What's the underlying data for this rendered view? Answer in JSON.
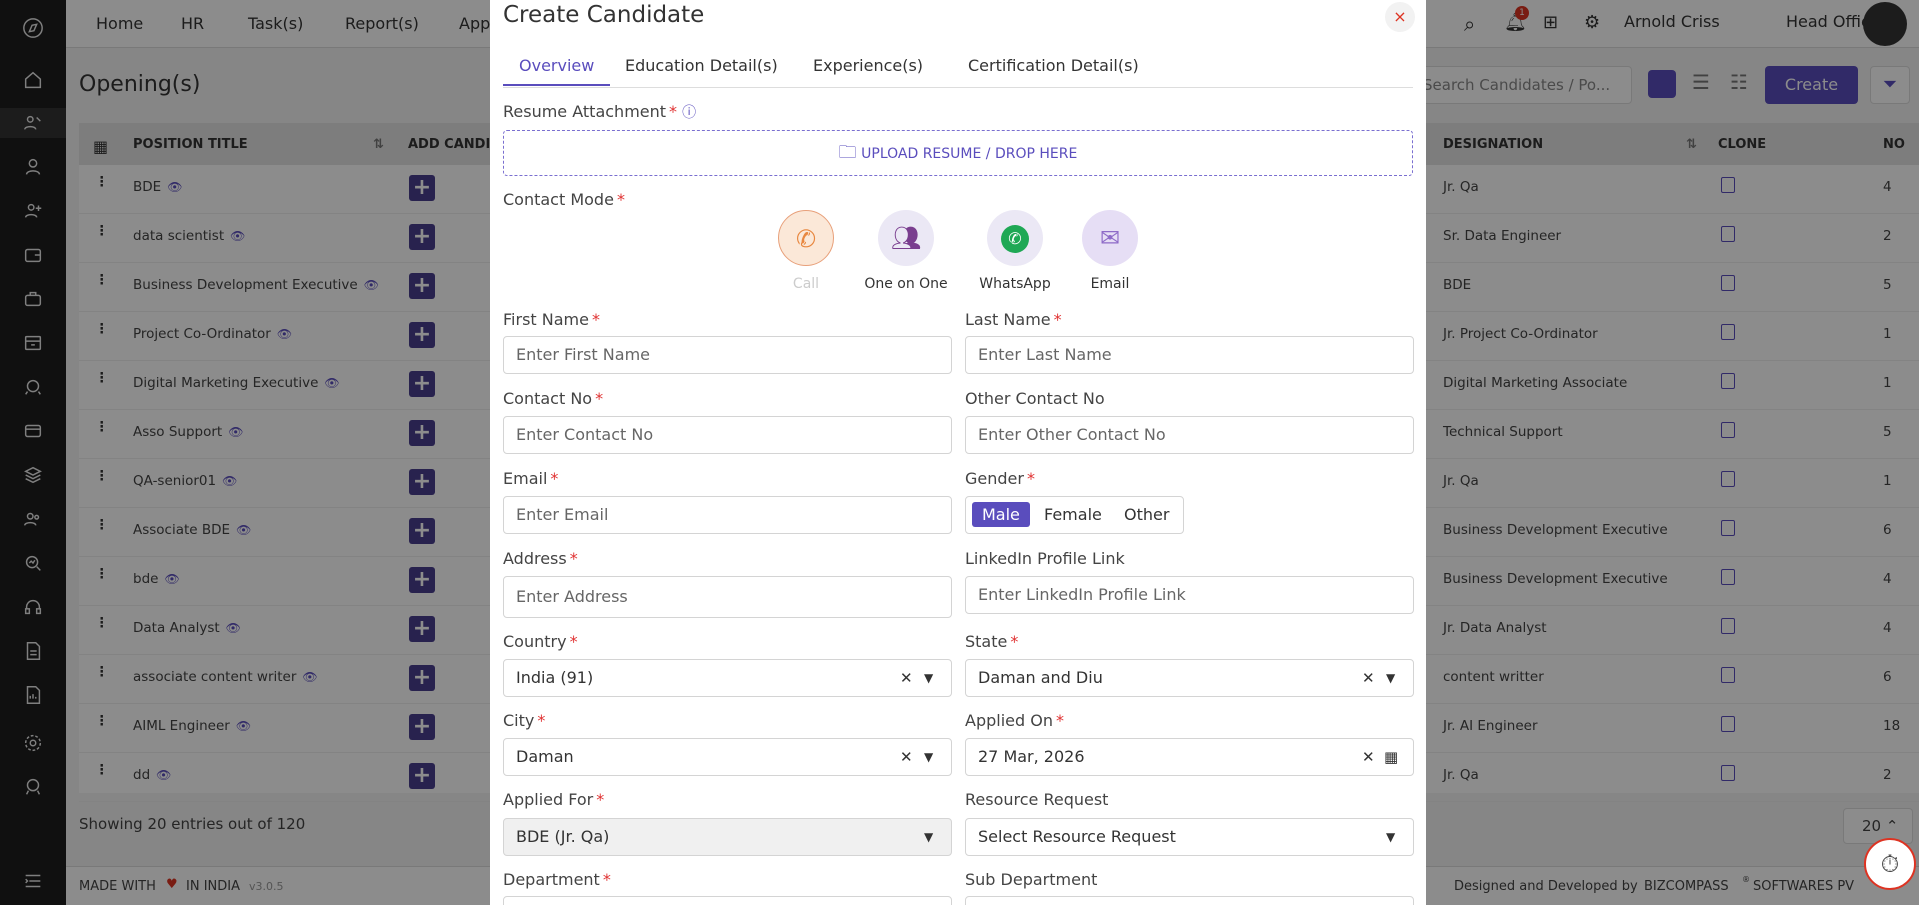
{
  "topnav": {
    "items": [
      "Home",
      "HR",
      "Task(s)",
      "Report(s)",
      "App"
    ],
    "user": "Arnold Criss",
    "office": "Head Office",
    "notif_count": "1"
  },
  "page": {
    "title": "Opening(s)",
    "search_placeholder": "Search Candidates / Po...",
    "create_label": "Create",
    "showing": "Showing 20 entries out of 120",
    "page_size": "20"
  },
  "table": {
    "headers": {
      "position": "POSITION TITLE",
      "add": "ADD CANDI",
      "designation": "DESIGNATION",
      "clone": "CLONE",
      "no": "NO"
    },
    "rows": [
      {
        "title": "BDE",
        "designation": "Jr. Qa",
        "no": "4"
      },
      {
        "title": "data scientist",
        "designation": "Sr. Data Engineer",
        "no": "2"
      },
      {
        "title": "Business Development Executive",
        "designation": "BDE",
        "no": "5"
      },
      {
        "title": "Project Co-Ordinator",
        "designation": "Jr. Project Co-Ordinator",
        "no": "1"
      },
      {
        "title": "Digital Marketing Executive",
        "designation": "Digital Marketing Associate",
        "no": "1"
      },
      {
        "title": "Asso Support",
        "designation": "Technical Support",
        "no": "5"
      },
      {
        "title": "QA-senior01",
        "designation": "Jr. Qa",
        "no": "1"
      },
      {
        "title": "Associate BDE",
        "designation": "Business Development Executive",
        "no": "6"
      },
      {
        "title": "bde",
        "designation": "Business Development Executive",
        "no": "4"
      },
      {
        "title": "Data Analyst",
        "designation": "Jr. Data Analyst",
        "no": "4"
      },
      {
        "title": "associate content writer",
        "designation": "content writter",
        "no": "6"
      },
      {
        "title": "AIML Engineer",
        "designation": "Jr. AI Engineer",
        "no": "18"
      },
      {
        "title": "dd",
        "designation": "Jr. Qa",
        "no": "2"
      }
    ]
  },
  "footer": {
    "made_with": "MADE WITH",
    "in_india": "IN INDIA",
    "version": "v3.0.5",
    "designed_by": "Designed and Developed by",
    "company": "BIZCOMPASS",
    "company_suffix": "SOFTWARES PV"
  },
  "modal": {
    "title": "Create Candidate",
    "close": "×",
    "tabs": [
      "Overview",
      "Education Detail(s)",
      "Experience(s)",
      "Certification Detail(s)"
    ],
    "resume_label": "Resume Attachment",
    "upload_text": "UPLOAD RESUME / DROP HERE",
    "contact_mode_label": "Contact Mode",
    "contact_modes": [
      "Call",
      "One on One",
      "WhatsApp",
      "Email"
    ],
    "first_name": {
      "label": "First Name",
      "placeholder": "Enter First Name"
    },
    "last_name": {
      "label": "Last Name",
      "placeholder": "Enter Last Name"
    },
    "contact_no": {
      "label": "Contact No",
      "placeholder": "Enter Contact No"
    },
    "other_contact": {
      "label": "Other Contact No",
      "placeholder": "Enter Other Contact No"
    },
    "email": {
      "label": "Email",
      "placeholder": "Enter Email"
    },
    "gender": {
      "label": "Gender",
      "options": [
        "Male",
        "Female",
        "Other"
      ],
      "selected": "Male"
    },
    "address": {
      "label": "Address",
      "placeholder": "Enter Address"
    },
    "linkedin": {
      "label": "LinkedIn Profile Link",
      "placeholder": "Enter LinkedIn Profile Link"
    },
    "country": {
      "label": "Country",
      "value": "India (91)"
    },
    "state": {
      "label": "State",
      "value": "Daman and Diu"
    },
    "city": {
      "label": "City",
      "value": "Daman"
    },
    "applied_on": {
      "label": "Applied On",
      "value": "27 Mar, 2026"
    },
    "applied_for": {
      "label": "Applied For",
      "value": "BDE (Jr. Qa)"
    },
    "resource_request": {
      "label": "Resource Request",
      "value": "Select Resource Request"
    },
    "department": {
      "label": "Department"
    },
    "sub_department": {
      "label": "Sub Department"
    }
  },
  "colors": {
    "accent": "#5a4dbd",
    "required": "#e03131",
    "sidebar": "#1e1e1e"
  }
}
